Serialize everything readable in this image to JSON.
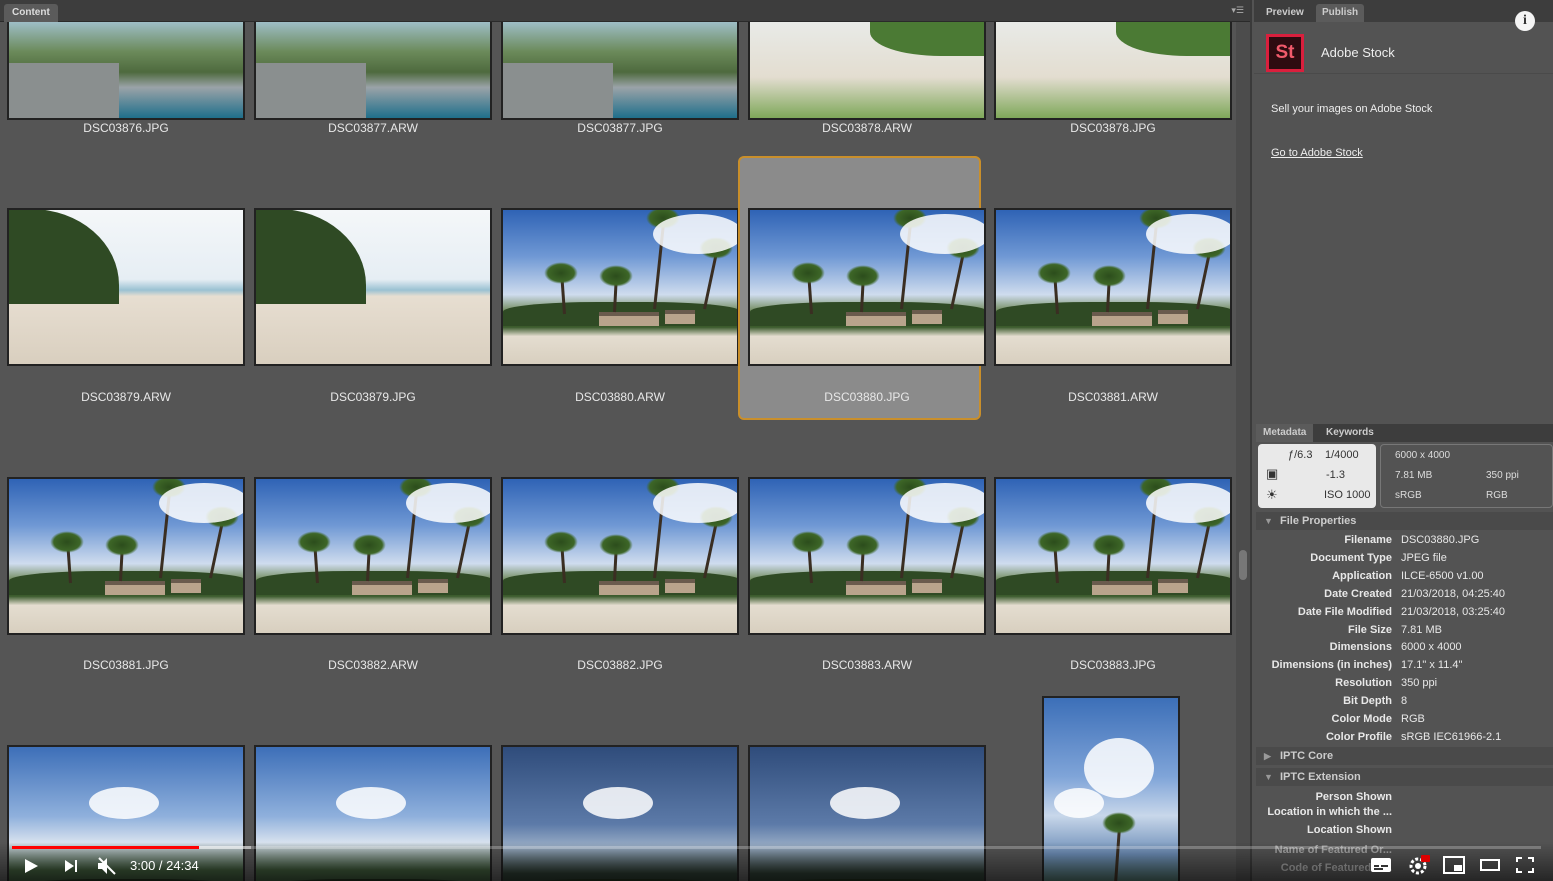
{
  "content_panel": {
    "tab_label": "Content",
    "thumbnails": [
      {
        "name": "DSC03876.JPG"
      },
      {
        "name": "DSC03877.ARW"
      },
      {
        "name": "DSC03877.JPG"
      },
      {
        "name": "DSC03878.ARW"
      },
      {
        "name": "DSC03878.JPG"
      },
      {
        "name": "DSC03879.ARW"
      },
      {
        "name": "DSC03879.JPG"
      },
      {
        "name": "DSC03880.ARW"
      },
      {
        "name": "DSC03880.JPG"
      },
      {
        "name": "DSC03881.ARW"
      },
      {
        "name": "DSC03881.JPG"
      },
      {
        "name": "DSC03882.ARW"
      },
      {
        "name": "DSC03882.JPG"
      },
      {
        "name": "DSC03883.ARW"
      },
      {
        "name": "DSC03883.JPG"
      },
      {
        "name": ""
      },
      {
        "name": ""
      },
      {
        "name": ""
      },
      {
        "name": ""
      },
      {
        "name": ""
      }
    ],
    "selected_index": 8,
    "selection_color": "#c98f2b"
  },
  "right_panel": {
    "tabs": [
      "Preview",
      "Publish"
    ],
    "active_tab": "Publish",
    "info_label": "i",
    "stock": {
      "logo_text": "St",
      "title": "Adobe Stock",
      "description": "Sell your images on Adobe Stock",
      "link": "Go to Adobe Stock",
      "brand_color": "#da1f3d"
    },
    "metadata_tabs": [
      "Metadata",
      "Keywords"
    ],
    "camera": {
      "aperture": "ƒ/6.3",
      "shutter": "1/4000",
      "exposure_comp": "-1.3",
      "iso": "ISO 1000",
      "dimensions": "6000 x 4000",
      "size": "7.81 MB",
      "ppi": "350 ppi",
      "color_space": "sRGB",
      "color_mode": "RGB"
    },
    "file_properties_header": "File Properties",
    "file_properties": [
      {
        "label": "Filename",
        "value": "DSC03880.JPG"
      },
      {
        "label": "Document Type",
        "value": "JPEG file"
      },
      {
        "label": "Application",
        "value": "ILCE-6500 v1.00"
      },
      {
        "label": "Date Created",
        "value": "21/03/2018, 04:25:40"
      },
      {
        "label": "Date File Modified",
        "value": "21/03/2018, 03:25:40"
      },
      {
        "label": "File Size",
        "value": "7.81 MB"
      },
      {
        "label": "Dimensions",
        "value": "6000 x 4000"
      },
      {
        "label": "Dimensions (in inches)",
        "value": "17.1\" x 11.4\""
      },
      {
        "label": "Resolution",
        "value": "350 ppi"
      },
      {
        "label": "Bit Depth",
        "value": "8"
      },
      {
        "label": "Color Mode",
        "value": "RGB"
      },
      {
        "label": "Color Profile",
        "value": "sRGB IEC61966-2.1"
      }
    ],
    "iptc_core_header": "IPTC Core",
    "iptc_extension_header": "IPTC Extension",
    "iptc_extension": [
      {
        "label": "Person Shown",
        "value": ""
      },
      {
        "label": "Location in which the ...",
        "value": ""
      },
      {
        "label": "Location Shown",
        "value": ""
      },
      {
        "label": "Name of Featured Or...",
        "value": ""
      },
      {
        "label": "Code of Featured O...",
        "value": ""
      }
    ]
  },
  "player": {
    "time_display": "3:00 / 24:34",
    "progress": 0.122,
    "buffered": 0.156,
    "play_icon": "play-icon",
    "accent": "#ff0000"
  }
}
